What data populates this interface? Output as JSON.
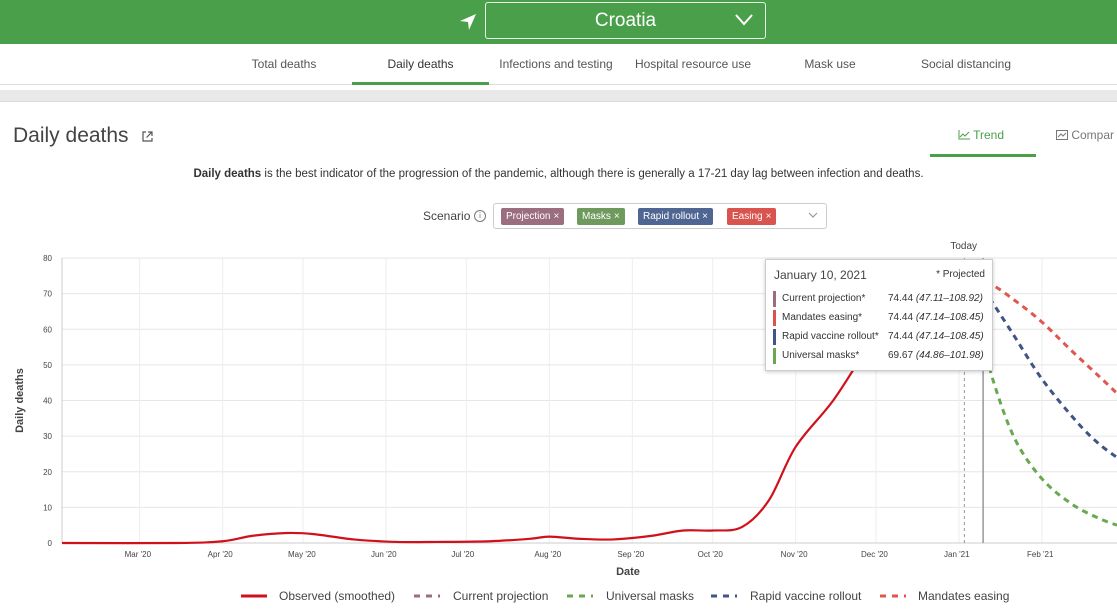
{
  "header": {
    "country": "Croatia",
    "location_icon": "location-arrow-icon",
    "dropdown_icon": "chevron-down-icon",
    "brand_color": "#4aa04a"
  },
  "nav": {
    "tabs": [
      {
        "label": "Total deaths",
        "active": false
      },
      {
        "label": "Daily deaths",
        "active": true
      },
      {
        "label": "Infections and testing",
        "active": false
      },
      {
        "label": "Hospital resource use",
        "active": false
      },
      {
        "label": "Mask use",
        "active": false
      },
      {
        "label": "Social distancing",
        "active": false
      }
    ]
  },
  "section": {
    "title": "Daily deaths",
    "external_icon": "external-link-icon",
    "view_tabs": {
      "trend": "Trend",
      "compare": "Compar"
    },
    "description_bold": "Daily deaths",
    "description_rest": " is the best indicator of the progression of the pandemic, although there is generally a 17-21 day lag between infection and deaths."
  },
  "scenario": {
    "label": "Scenario",
    "chips": [
      {
        "label": "Projection",
        "color": "#9a6e7e"
      },
      {
        "label": "Masks",
        "color": "#6f9a5e"
      },
      {
        "label": "Rapid rollout",
        "color": "#4f6592"
      },
      {
        "label": "Easing",
        "color": "#d9534f"
      }
    ]
  },
  "tooltip": {
    "date": "January 10, 2021",
    "projected_note": "* Projected",
    "rows": [
      {
        "name": "Current projection*",
        "value": "74.44",
        "range": "(47.11–108.92)",
        "color": "#9a6e7e"
      },
      {
        "name": "Mandates easing*",
        "value": "74.44",
        "range": "(47.14–108.45)",
        "color": "#d9534f"
      },
      {
        "name": "Rapid vaccine rollout*",
        "value": "74.44",
        "range": "(47.14–108.45)",
        "color": "#3f5585"
      },
      {
        "name": "Universal masks*",
        "value": "69.67",
        "range": "(44.86–101.98)",
        "color": "#6aa84f"
      }
    ]
  },
  "chart_data": {
    "type": "line",
    "xlabel": "Date",
    "ylabel": "Daily deaths",
    "today_label": "Today",
    "today_date": "2021-01-03",
    "hover_date": "2021-01-10",
    "ylim": [
      0,
      80
    ],
    "yticks": [
      0,
      10,
      20,
      30,
      40,
      50,
      60,
      70,
      80
    ],
    "xlim": [
      "2020-02-01",
      "2021-03-01"
    ],
    "xticks": [
      {
        "label": "Mar '20",
        "date": "2020-03-01"
      },
      {
        "label": "Apr '20",
        "date": "2020-04-01"
      },
      {
        "label": "May '20",
        "date": "2020-05-01"
      },
      {
        "label": "Jun '20",
        "date": "2020-06-01"
      },
      {
        "label": "Jul '20",
        "date": "2020-07-01"
      },
      {
        "label": "Aug '20",
        "date": "2020-08-01"
      },
      {
        "label": "Sep '20",
        "date": "2020-09-01"
      },
      {
        "label": "Oct '20",
        "date": "2020-10-01"
      },
      {
        "label": "Nov '20",
        "date": "2020-11-01"
      },
      {
        "label": "Dec '20",
        "date": "2020-12-01"
      },
      {
        "label": "Jan '21",
        "date": "2021-01-01"
      },
      {
        "label": "Feb '21",
        "date": "2021-02-01"
      }
    ],
    "grid": true,
    "legend_position": "bottom",
    "series": [
      {
        "name": "Observed (smoothed)",
        "style": "solid",
        "color": "#d0111b",
        "points": [
          [
            "2020-02-01",
            0
          ],
          [
            "2020-03-15",
            0
          ],
          [
            "2020-04-01",
            0.5
          ],
          [
            "2020-04-12",
            2
          ],
          [
            "2020-04-25",
            2.8
          ],
          [
            "2020-05-05",
            2.5
          ],
          [
            "2020-05-20",
            1.0
          ],
          [
            "2020-06-05",
            0.3
          ],
          [
            "2020-06-20",
            0.3
          ],
          [
            "2020-07-10",
            0.5
          ],
          [
            "2020-07-25",
            1.2
          ],
          [
            "2020-08-01",
            1.8
          ],
          [
            "2020-08-12",
            1.2
          ],
          [
            "2020-08-25",
            1.0
          ],
          [
            "2020-09-08",
            2.0
          ],
          [
            "2020-09-20",
            3.5
          ],
          [
            "2020-10-01",
            3.5
          ],
          [
            "2020-10-12",
            4.5
          ],
          [
            "2020-10-22",
            12
          ],
          [
            "2020-11-01",
            27
          ],
          [
            "2020-11-15",
            40
          ],
          [
            "2020-11-28",
            55
          ],
          [
            "2020-12-08",
            65
          ],
          [
            "2020-12-18",
            70
          ],
          [
            "2020-12-28",
            73
          ],
          [
            "2021-01-03",
            74.4
          ]
        ]
      },
      {
        "name": "Current projection",
        "style": "dashed",
        "color": "#9a6e7e",
        "points": [
          [
            "2021-01-03",
            74.44
          ],
          [
            "2021-01-10",
            74.44
          ]
        ]
      },
      {
        "name": "Universal masks",
        "style": "dashed",
        "color": "#6aa84f",
        "points": [
          [
            "2021-01-03",
            69.67
          ],
          [
            "2021-01-08",
            62
          ],
          [
            "2021-01-14",
            45
          ],
          [
            "2021-01-22",
            29
          ],
          [
            "2021-02-01",
            18
          ],
          [
            "2021-02-12",
            11
          ],
          [
            "2021-02-22",
            7
          ],
          [
            "2021-03-01",
            5
          ]
        ]
      },
      {
        "name": "Rapid vaccine rollout",
        "style": "dashed",
        "color": "#3f5585",
        "points": [
          [
            "2021-01-03",
            74.44
          ],
          [
            "2021-01-10",
            71
          ],
          [
            "2021-01-20",
            60
          ],
          [
            "2021-02-01",
            46
          ],
          [
            "2021-02-14",
            34
          ],
          [
            "2021-02-22",
            28
          ],
          [
            "2021-03-01",
            24
          ]
        ]
      },
      {
        "name": "Mandates easing",
        "style": "dashed",
        "color": "#e0574f",
        "points": [
          [
            "2021-01-03",
            74.44
          ],
          [
            "2021-01-12",
            73
          ],
          [
            "2021-01-22",
            68
          ],
          [
            "2021-02-01",
            62
          ],
          [
            "2021-02-12",
            54
          ],
          [
            "2021-02-22",
            47
          ],
          [
            "2021-03-01",
            42
          ]
        ]
      }
    ]
  }
}
